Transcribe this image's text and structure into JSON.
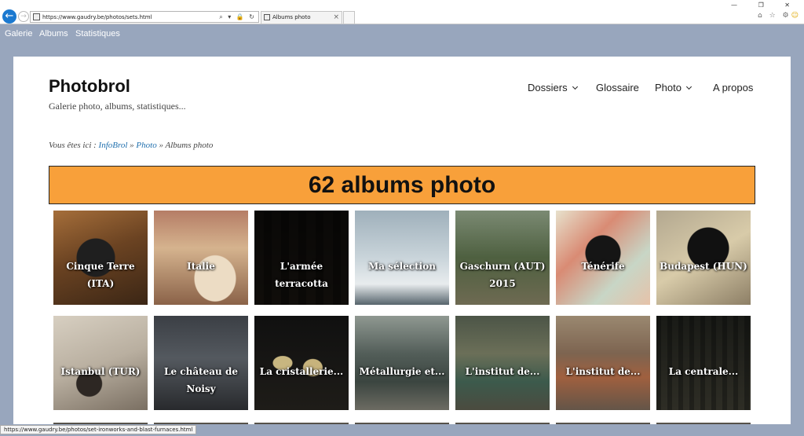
{
  "browser": {
    "url": "https://www.gaudry.be/photos/sets.html",
    "tab_title": "Albums photo",
    "back_glyph": "←",
    "forward_glyph": "→",
    "addr_icons": "⌕ ▾ 🔒 ↻",
    "tab_close_glyph": "×",
    "window_controls": "— ❐ ✕",
    "toolbar_icons": "⌂ ☆ ⚙",
    "smiley": "☺"
  },
  "topbar": {
    "items": [
      "Galerie",
      "Albums",
      "Statistiques"
    ]
  },
  "site": {
    "title": "Photobrol",
    "description": "Galerie photo, albums, statistiques..."
  },
  "menu": {
    "items": [
      {
        "label": "Dossiers",
        "has_dropdown": true
      },
      {
        "label": "Glossaire",
        "has_dropdown": false
      },
      {
        "label": "Photo",
        "has_dropdown": true
      },
      {
        "label": "A propos",
        "has_dropdown": false
      }
    ]
  },
  "breadcrumb": {
    "prefix": "Vous êtes ici :",
    "links": [
      "InfoBrol",
      "Photo"
    ],
    "separator": "»",
    "current": "Albums photo"
  },
  "banner": {
    "title": "62 albums photo",
    "color": "#f8a03a"
  },
  "albums": [
    {
      "label": "Cinque Terre (ITA)"
    },
    {
      "label": "Italie"
    },
    {
      "label": "L'armée terracotta"
    },
    {
      "label": "Ma sélection"
    },
    {
      "label": "Gaschurn (AUT) 2015"
    },
    {
      "label": "Ténérife"
    },
    {
      "label": "Budapest (HUN)"
    },
    {
      "label": "Istanbul (TUR)"
    },
    {
      "label": "Le château de Noisy"
    },
    {
      "label": "La cristallerie..."
    },
    {
      "label": "Métallurgie et..."
    },
    {
      "label": "L'institut de..."
    },
    {
      "label": "L'institut de..."
    },
    {
      "label": "La centrale..."
    }
  ],
  "status_bar": {
    "text": "https://www.gaudry.be/photos/set-ironworks-and-blast-furnaces.html"
  }
}
